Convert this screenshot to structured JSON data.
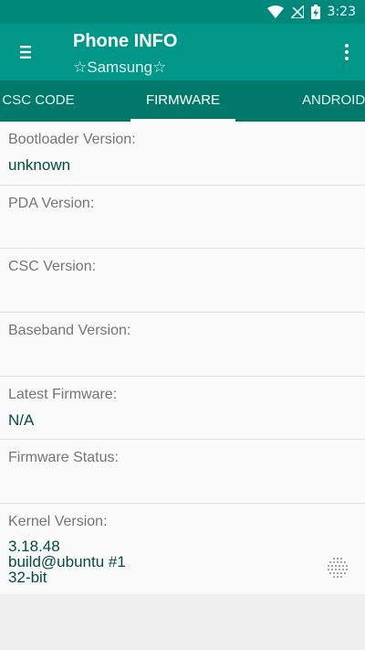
{
  "status_bar": {
    "time": "3:23",
    "icons": [
      "wifi-icon",
      "no-signal-icon",
      "battery-charging-icon"
    ]
  },
  "app_bar": {
    "title": "Phone INFO",
    "subtitle": "☆Samsung☆",
    "menu_icon": "hamburger-menu-icon",
    "overflow_icon": "more-vert-icon"
  },
  "tabs": [
    {
      "label": "CSC CODE"
    },
    {
      "label": "FIRMWARE",
      "active": true
    },
    {
      "label": "ANDROID"
    }
  ],
  "rows": [
    {
      "label": "Bootloader Version:",
      "value": "unknown"
    },
    {
      "label": "PDA Version:",
      "value": ""
    },
    {
      "label": "CSC Version:",
      "value": ""
    },
    {
      "label": "Baseband Version:",
      "value": ""
    },
    {
      "label": "Latest Firmware:",
      "value": "N/A"
    },
    {
      "label": "Firmware Status:",
      "value": ""
    }
  ],
  "kernel": {
    "label": "Kernel Version:",
    "lines": [
      "3.18.48",
      "build@ubuntu #1",
      "32-bit"
    ]
  },
  "colors": {
    "status_bar": "#00897b",
    "app_bar": "#009688",
    "tab_bar": "#00796b",
    "value_text": "#004d40",
    "label_text": "#757575"
  }
}
